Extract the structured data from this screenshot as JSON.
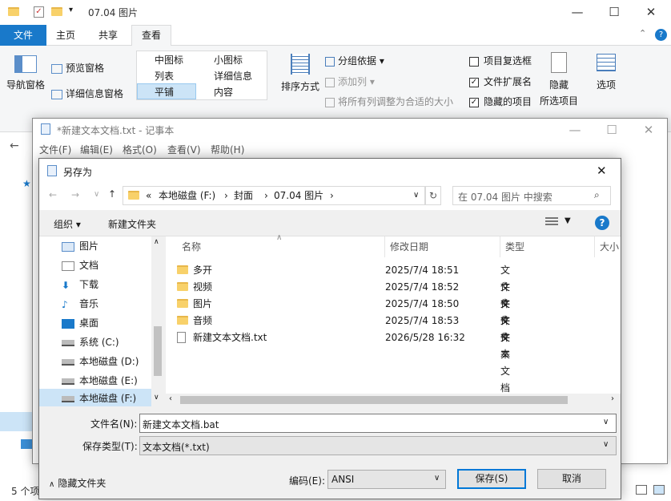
{
  "explorer": {
    "title": "07.04 图片",
    "tabs": [
      "文件",
      "主页",
      "共享",
      "查看"
    ],
    "ribbon": {
      "nav_pane": "导航窗格",
      "preview_pane": "预览窗格",
      "details_pane": "详细信息窗格",
      "layouts": [
        "中图标",
        "小图标",
        "列表",
        "详细信息",
        "平铺",
        "内容"
      ],
      "sort_by": "排序方式",
      "group_by": "分组依据",
      "add_column": "添加列",
      "fit_columns": "将所有列调整为合适的大小",
      "item_checkbox": "项目复选框",
      "file_ext": "文件扩展名",
      "hidden_items": "隐藏的项目",
      "hide_selected": "隐藏",
      "hide_selected2": "所选项目",
      "options": "选项"
    },
    "status": "5 个项"
  },
  "notepad": {
    "title": "*新建文本文档.txt - 记事本",
    "menu": [
      "文件(F)",
      "编辑(E)",
      "格式(O)",
      "查看(V)",
      "帮助(H)"
    ]
  },
  "dialog": {
    "title": "另存为",
    "breadcrumb": [
      "«",
      "本地磁盘 (F:)",
      "封面",
      "07.04 图片"
    ],
    "search_placeholder": "在 07.04 图片 中搜索",
    "organize": "组织 ▾",
    "new_folder": "新建文件夹",
    "sidebar": [
      {
        "label": "图片",
        "icon": "pictures-icon"
      },
      {
        "label": "文档",
        "icon": "documents-icon"
      },
      {
        "label": "下载",
        "icon": "download-icon"
      },
      {
        "label": "音乐",
        "icon": "music-icon"
      },
      {
        "label": "桌面",
        "icon": "desktop-icon"
      },
      {
        "label": "系统 (C:)",
        "icon": "drive-icon"
      },
      {
        "label": "本地磁盘 (D:)",
        "icon": "drive-icon"
      },
      {
        "label": "本地磁盘 (E:)",
        "icon": "drive-icon"
      },
      {
        "label": "本地磁盘 (F:)",
        "icon": "drive-icon"
      }
    ],
    "columns": [
      "名称",
      "修改日期",
      "类型",
      "大小"
    ],
    "files": [
      {
        "name": "多开",
        "date": "2025/7/4 18:51",
        "type": "文件夹"
      },
      {
        "name": "视频",
        "date": "2025/7/4 18:52",
        "type": "文件夹"
      },
      {
        "name": "图片",
        "date": "2025/7/4 18:50",
        "type": "文件夹"
      },
      {
        "name": "音频",
        "date": "2025/7/4 18:53",
        "type": "文件夹"
      },
      {
        "name": "新建文本文档.txt",
        "date": "2026/5/28 16:32",
        "type": "文本文档"
      }
    ],
    "filename_label": "文件名(N):",
    "filename_value": "新建文本文档.bat",
    "filetype_label": "保存类型(T):",
    "filetype_value": "文本文档(*.txt)",
    "hide_folders": "隐藏文件夹",
    "encoding_label": "编码(E):",
    "encoding_value": "ANSI",
    "save": "保存(S)",
    "cancel": "取消"
  }
}
